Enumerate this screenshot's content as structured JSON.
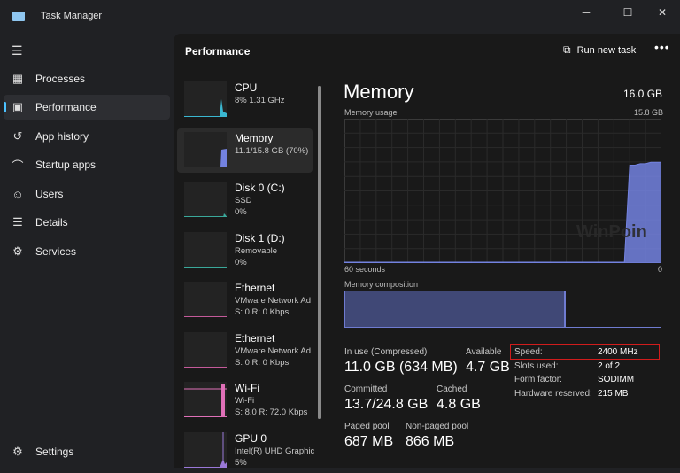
{
  "window": {
    "title": "Task Manager",
    "minimize": "─",
    "maximize": "☐",
    "close": "✕"
  },
  "sidebar": {
    "items": [
      {
        "label": "Processes",
        "icon": "processes-icon",
        "glyph": "▦"
      },
      {
        "label": "Performance",
        "icon": "performance-icon",
        "glyph": "▣",
        "active": true
      },
      {
        "label": "App history",
        "icon": "history-icon",
        "glyph": "↺"
      },
      {
        "label": "Startup apps",
        "icon": "startup-icon",
        "glyph": "⌒"
      },
      {
        "label": "Users",
        "icon": "users-icon",
        "glyph": "☺"
      },
      {
        "label": "Details",
        "icon": "details-icon",
        "glyph": "☰"
      },
      {
        "label": "Services",
        "icon": "services-icon",
        "glyph": "⚙"
      }
    ],
    "settings": {
      "label": "Settings",
      "glyph": "⚙"
    }
  },
  "header": {
    "title": "Performance",
    "run_new_task": "Run new task",
    "more": "•••"
  },
  "devices": [
    {
      "name": "CPU",
      "line1": "8%  1.31 GHz",
      "line2": "",
      "color": "#3ab7d0"
    },
    {
      "name": "Memory",
      "line1": "11.1/15.8 GB (70%)",
      "line2": "",
      "color": "#7382e0",
      "active": true
    },
    {
      "name": "Disk 0 (C:)",
      "line1": "SSD",
      "line2": "0%",
      "color": "#3aa89a"
    },
    {
      "name": "Disk 1 (D:)",
      "line1": "Removable",
      "line2": "0%",
      "color": "#3aa89a"
    },
    {
      "name": "Ethernet",
      "line1": "VMware Network Ad",
      "line2": "S: 0 R: 0 Kbps",
      "color": "#c45a9a"
    },
    {
      "name": "Ethernet",
      "line1": "VMware Network Ad",
      "line2": "S: 0 R: 0 Kbps",
      "color": "#c45a9a"
    },
    {
      "name": "Wi-Fi",
      "line1": "Wi-Fi",
      "line2": "S: 8.0 R: 72.0 Kbps",
      "color": "#e070b8"
    },
    {
      "name": "GPU 0",
      "line1": "Intel(R) UHD Graphics",
      "line2": "5%",
      "color": "#9a78d8"
    }
  ],
  "memory": {
    "title": "Memory",
    "total": "16.0 GB",
    "usage_label": "Memory usage",
    "usage_max": "15.8 GB",
    "time_left": "60 seconds",
    "time_right": "0",
    "composition_label": "Memory composition",
    "composition_in_use_pct": 70,
    "usage_history_pct": [
      0,
      0,
      0,
      0,
      0,
      0,
      0,
      0,
      0,
      0,
      0,
      0,
      0,
      0,
      0,
      0,
      0,
      0,
      0,
      0,
      0,
      0,
      0,
      0,
      0,
      0,
      0,
      0,
      0,
      0,
      0,
      0,
      0,
      0,
      0,
      0,
      0,
      0,
      0,
      0,
      0,
      0,
      0,
      0,
      0,
      0,
      0,
      0,
      0,
      0,
      0,
      0,
      0,
      0,
      68,
      68,
      69,
      69,
      70,
      70,
      70
    ],
    "accent": "#7382e0",
    "stats": [
      {
        "label": "In use (Compressed)",
        "value": "11.0 GB (634 MB)"
      },
      {
        "label": "Available",
        "value": "4.7 GB"
      },
      {
        "label": "Committed",
        "value": "13.7/24.8 GB"
      },
      {
        "label": "Cached",
        "value": "4.8 GB"
      },
      {
        "label": "Paged pool",
        "value": "687 MB"
      },
      {
        "label": "Non-paged pool",
        "value": "866 MB"
      }
    ],
    "details": [
      {
        "key": "Speed:",
        "value": "2400 MHz"
      },
      {
        "key": "Slots used:",
        "value": "2 of 2"
      },
      {
        "key": "Form factor:",
        "value": "SODIMM"
      },
      {
        "key": "Hardware reserved:",
        "value": "215 MB"
      }
    ]
  },
  "watermark": "WinPoin"
}
